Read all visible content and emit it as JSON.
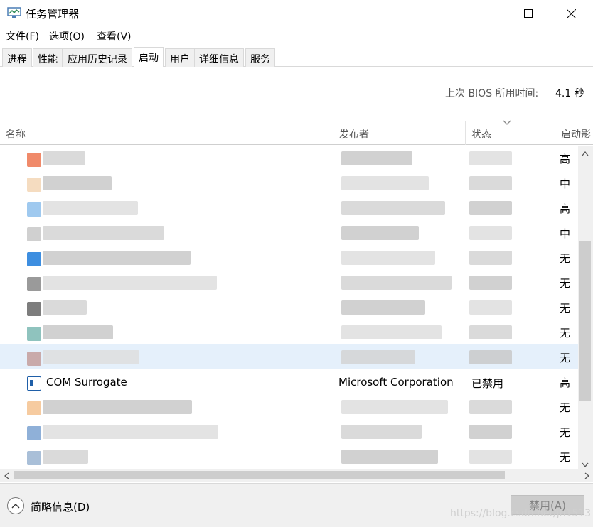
{
  "window": {
    "title": "任务管理器",
    "minimize_icon": "minimize-icon",
    "maximize_icon": "maximize-icon",
    "close_icon": "close-icon"
  },
  "menu": [
    "文件(F)",
    "选项(O)",
    "查看(V)"
  ],
  "tabs": [
    "进程",
    "性能",
    "应用历史记录",
    "启动",
    "用户",
    "详细信息",
    "服务"
  ],
  "active_tab": "启动",
  "boot_time": {
    "label": "上次 BIOS 所用时间:",
    "value": "4.1 秒"
  },
  "columns": {
    "name": "名称",
    "publisher": "发布者",
    "status": "状态",
    "impact": "启动影"
  },
  "rows": [
    {
      "impact": "高",
      "icon_color": "#f08a6a"
    },
    {
      "impact": "中",
      "icon_color": "#f5dcc0"
    },
    {
      "impact": "高",
      "icon_color": "#9fc9ef"
    },
    {
      "impact": "中",
      "icon_color": "#d0d0d0"
    },
    {
      "impact": "无",
      "icon_color": "#3d8ee0"
    },
    {
      "impact": "无",
      "icon_color": "#9a9a9a"
    },
    {
      "impact": "无",
      "icon_color": "#7d7d7d"
    },
    {
      "impact": "无",
      "icon_color": "#8fc3be"
    },
    {
      "impact": "无",
      "icon_color": "#c9aaaa"
    },
    {
      "impact": "高",
      "name": "COM Surrogate",
      "publisher": "Microsoft Corporation",
      "status": "已禁用",
      "icon_color": "#1f5fa8"
    },
    {
      "impact": "无",
      "icon_color": "#f6cba0"
    },
    {
      "impact": "无",
      "icon_color": "#8fb0d8"
    },
    {
      "impact": "无",
      "icon_color": "#a9bfd8"
    }
  ],
  "footer": {
    "fewer_details": "简略信息(D)",
    "disable_button": "禁用(A)",
    "watermark": "https://blog.csdn.net/jh1513"
  }
}
